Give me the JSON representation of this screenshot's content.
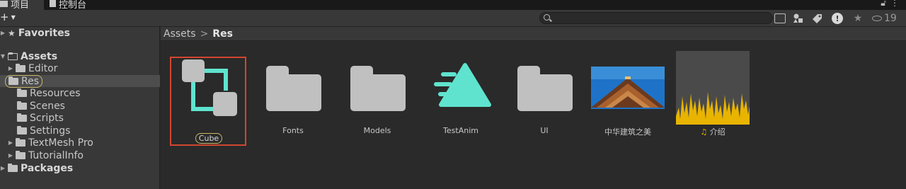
{
  "tabs": [
    {
      "label": "项目",
      "icon": "folder-icon"
    },
    {
      "label": "控制台",
      "icon": "console-icon"
    }
  ],
  "window_controls": {
    "lock_icon": "lock-icon",
    "menu_icon": "kebab-menu-icon"
  },
  "toolbar": {
    "add_label": "+",
    "search": {
      "value": "",
      "placeholder": ""
    },
    "hidden_count": "19"
  },
  "tree": {
    "favorites": "Favorites",
    "assets": "Assets",
    "assets_children": [
      "Editor",
      "Res",
      "Resources",
      "Scenes",
      "Scripts",
      "Settings",
      "TextMesh Pro",
      "TutorialInfo"
    ],
    "packages": "Packages"
  },
  "breadcrumb": {
    "root": "Assets",
    "separator": ">",
    "current": "Res"
  },
  "grid_items": [
    {
      "name": "Cube",
      "type": "prefab"
    },
    {
      "name": "Fonts",
      "type": "folder"
    },
    {
      "name": "Models",
      "type": "folder"
    },
    {
      "name": "TestAnim",
      "type": "animation"
    },
    {
      "name": "UI",
      "type": "folder"
    },
    {
      "name": "中华建筑之美",
      "type": "image"
    },
    {
      "name": "介绍",
      "type": "audio"
    }
  ],
  "colors": {
    "selection_outline": "#d0472f",
    "highlight_pill": "#c9b86a",
    "prefab_teal": "#5fe3cf",
    "audio_wave": "#e8b400",
    "sky_blue": "#1e73c8"
  }
}
